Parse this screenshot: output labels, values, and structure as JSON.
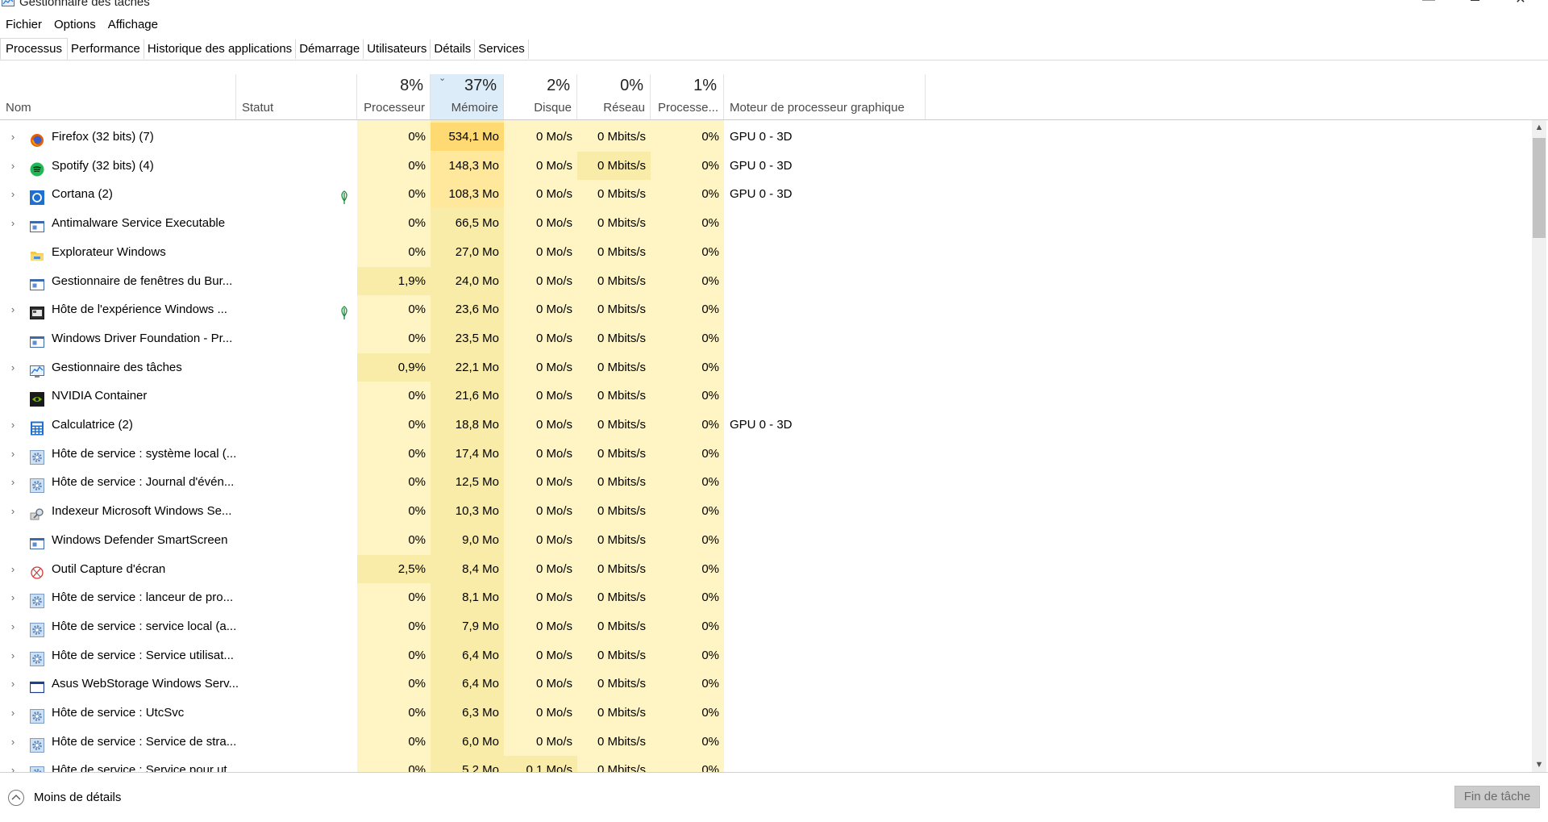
{
  "window": {
    "title": "Gestionnaire des tâches",
    "minimize_glyph": "—",
    "close_glyph": "✕"
  },
  "menu": [
    "Fichier",
    "Options",
    "Affichage"
  ],
  "tabs": [
    {
      "label": "Processus",
      "active": true
    },
    {
      "label": "Performance",
      "active": false
    },
    {
      "label": "Historique des applications",
      "active": false
    },
    {
      "label": "Démarrage",
      "active": false
    },
    {
      "label": "Utilisateurs",
      "active": false
    },
    {
      "label": "Détails",
      "active": false
    },
    {
      "label": "Services",
      "active": false
    }
  ],
  "columns": {
    "name": "Nom",
    "status": "Statut",
    "cpu": {
      "pct": "8%",
      "label": "Processeur"
    },
    "memory": {
      "pct": "37%",
      "label": "Mémoire",
      "sorted": true
    },
    "disk": {
      "pct": "2%",
      "label": "Disque"
    },
    "network": {
      "pct": "0%",
      "label": "Réseau"
    },
    "gpu": {
      "pct": "1%",
      "label": "Processe..."
    },
    "gpu_engine": "Moteur de processeur graphique"
  },
  "colors": {
    "cell_light": "#fff4c4",
    "cell_medium": "#f9eca8",
    "cell_strong": "#ffd972",
    "sorted_header": "#dcecf9"
  },
  "processes": [
    {
      "name": "Firefox (32 bits) (7)",
      "icon": "firefox-icon",
      "expandable": true,
      "leaf": false,
      "cpu": "0%",
      "mem": "534,1 Mo",
      "disk": "0 Mo/s",
      "net": "0 Mbits/s",
      "gpu": "0%",
      "gpu_engine": "GPU 0 - 3D"
    },
    {
      "name": "Spotify (32 bits) (4)",
      "icon": "spotify-icon",
      "expandable": true,
      "leaf": false,
      "cpu": "0%",
      "mem": "148,3 Mo",
      "disk": "0 Mo/s",
      "net": "0 Mbits/s",
      "gpu": "0%",
      "gpu_engine": "GPU 0 - 3D"
    },
    {
      "name": "Cortana (2)",
      "icon": "cortana-icon",
      "expandable": true,
      "leaf": true,
      "cpu": "0%",
      "mem": "108,3 Mo",
      "disk": "0 Mo/s",
      "net": "0 Mbits/s",
      "gpu": "0%",
      "gpu_engine": "GPU 0 - 3D"
    },
    {
      "name": "Antimalware Service Executable",
      "icon": "app-window-icon",
      "expandable": true,
      "leaf": false,
      "cpu": "0%",
      "mem": "66,5 Mo",
      "disk": "0 Mo/s",
      "net": "0 Mbits/s",
      "gpu": "0%",
      "gpu_engine": ""
    },
    {
      "name": "Explorateur Windows",
      "icon": "folder-icon",
      "expandable": false,
      "leaf": false,
      "cpu": "0%",
      "mem": "27,0 Mo",
      "disk": "0 Mo/s",
      "net": "0 Mbits/s",
      "gpu": "0%",
      "gpu_engine": ""
    },
    {
      "name": "Gestionnaire de fenêtres du Bur...",
      "icon": "app-window-icon",
      "expandable": false,
      "leaf": false,
      "cpu": "1,9%",
      "mem": "24,0 Mo",
      "disk": "0 Mo/s",
      "net": "0 Mbits/s",
      "gpu": "0%",
      "gpu_engine": ""
    },
    {
      "name": "Hôte de l'expérience Windows ...",
      "icon": "dark-window-icon",
      "expandable": true,
      "leaf": true,
      "cpu": "0%",
      "mem": "23,6 Mo",
      "disk": "0 Mo/s",
      "net": "0 Mbits/s",
      "gpu": "0%",
      "gpu_engine": ""
    },
    {
      "name": "Windows Driver Foundation - Pr...",
      "icon": "app-window-icon",
      "expandable": false,
      "leaf": false,
      "cpu": "0%",
      "mem": "23,5 Mo",
      "disk": "0 Mo/s",
      "net": "0 Mbits/s",
      "gpu": "0%",
      "gpu_engine": ""
    },
    {
      "name": "Gestionnaire des tâches",
      "icon": "task-manager-icon",
      "expandable": true,
      "leaf": false,
      "cpu": "0,9%",
      "mem": "22,1 Mo",
      "disk": "0 Mo/s",
      "net": "0 Mbits/s",
      "gpu": "0%",
      "gpu_engine": ""
    },
    {
      "name": "NVIDIA Container",
      "icon": "nvidia-icon",
      "expandable": false,
      "leaf": false,
      "cpu": "0%",
      "mem": "21,6 Mo",
      "disk": "0 Mo/s",
      "net": "0 Mbits/s",
      "gpu": "0%",
      "gpu_engine": ""
    },
    {
      "name": "Calculatrice (2)",
      "icon": "calculator-icon",
      "expandable": true,
      "leaf": false,
      "cpu": "0%",
      "mem": "18,8 Mo",
      "disk": "0 Mo/s",
      "net": "0 Mbits/s",
      "gpu": "0%",
      "gpu_engine": "GPU 0 - 3D"
    },
    {
      "name": "Hôte de service : système local (...",
      "icon": "gear-icon",
      "expandable": true,
      "leaf": false,
      "cpu": "0%",
      "mem": "17,4 Mo",
      "disk": "0 Mo/s",
      "net": "0 Mbits/s",
      "gpu": "0%",
      "gpu_engine": ""
    },
    {
      "name": "Hôte de service : Journal d'évén...",
      "icon": "gear-icon",
      "expandable": true,
      "leaf": false,
      "cpu": "0%",
      "mem": "12,5 Mo",
      "disk": "0 Mo/s",
      "net": "0 Mbits/s",
      "gpu": "0%",
      "gpu_engine": ""
    },
    {
      "name": "Indexeur Microsoft Windows Se...",
      "icon": "search-indexer-icon",
      "expandable": true,
      "leaf": false,
      "cpu": "0%",
      "mem": "10,3 Mo",
      "disk": "0 Mo/s",
      "net": "0 Mbits/s",
      "gpu": "0%",
      "gpu_engine": ""
    },
    {
      "name": "Windows Defender SmartScreen",
      "icon": "app-window-icon",
      "expandable": false,
      "leaf": false,
      "cpu": "0%",
      "mem": "9,0 Mo",
      "disk": "0 Mo/s",
      "net": "0 Mbits/s",
      "gpu": "0%",
      "gpu_engine": ""
    },
    {
      "name": "Outil Capture d'écran",
      "icon": "snipping-tool-icon",
      "expandable": true,
      "leaf": false,
      "cpu": "2,5%",
      "mem": "8,4 Mo",
      "disk": "0 Mo/s",
      "net": "0 Mbits/s",
      "gpu": "0%",
      "gpu_engine": ""
    },
    {
      "name": "Hôte de service : lanceur de pro...",
      "icon": "gear-icon",
      "expandable": true,
      "leaf": false,
      "cpu": "0%",
      "mem": "8,1 Mo",
      "disk": "0 Mo/s",
      "net": "0 Mbits/s",
      "gpu": "0%",
      "gpu_engine": ""
    },
    {
      "name": "Hôte de service : service local (a...",
      "icon": "gear-icon",
      "expandable": true,
      "leaf": false,
      "cpu": "0%",
      "mem": "7,9 Mo",
      "disk": "0 Mo/s",
      "net": "0 Mbits/s",
      "gpu": "0%",
      "gpu_engine": ""
    },
    {
      "name": "Hôte de service : Service utilisat...",
      "icon": "gear-icon",
      "expandable": true,
      "leaf": false,
      "cpu": "0%",
      "mem": "6,4 Mo",
      "disk": "0 Mo/s",
      "net": "0 Mbits/s",
      "gpu": "0%",
      "gpu_engine": ""
    },
    {
      "name": "Asus WebStorage Windows Serv...",
      "icon": "blank-window-icon",
      "expandable": true,
      "leaf": false,
      "cpu": "0%",
      "mem": "6,4 Mo",
      "disk": "0 Mo/s",
      "net": "0 Mbits/s",
      "gpu": "0%",
      "gpu_engine": ""
    },
    {
      "name": "Hôte de service : UtcSvc",
      "icon": "gear-icon",
      "expandable": true,
      "leaf": false,
      "cpu": "0%",
      "mem": "6,3 Mo",
      "disk": "0 Mo/s",
      "net": "0 Mbits/s",
      "gpu": "0%",
      "gpu_engine": ""
    },
    {
      "name": "Hôte de service : Service de stra...",
      "icon": "gear-icon",
      "expandable": true,
      "leaf": false,
      "cpu": "0%",
      "mem": "6,0 Mo",
      "disk": "0 Mo/s",
      "net": "0 Mbits/s",
      "gpu": "0%",
      "gpu_engine": ""
    },
    {
      "name": "Hôte de service : Service pour ut...",
      "icon": "gear-icon",
      "expandable": true,
      "leaf": false,
      "cpu": "0%",
      "mem": "5,2 Mo",
      "disk": "0,1 Mo/s",
      "net": "0 Mbits/s",
      "gpu": "0%",
      "gpu_engine": ""
    }
  ],
  "footer": {
    "less_details": "Moins de détails",
    "end_task": "Fin de tâche"
  }
}
